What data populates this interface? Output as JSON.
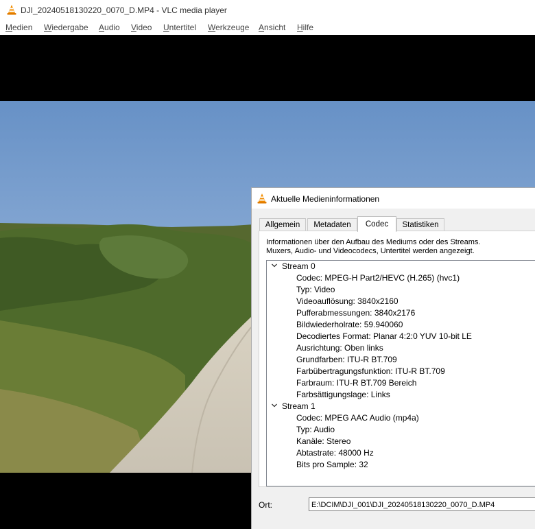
{
  "window": {
    "title": "DJI_20240518130220_0070_D.MP4 - VLC media player"
  },
  "menubar": {
    "items": [
      "Medien",
      "Wiedergabe",
      "Audio",
      "Video",
      "Untertitel",
      "Werkzeuge",
      "Ansicht",
      "Hilfe"
    ]
  },
  "dialog": {
    "title": "Aktuelle Medieninformationen",
    "tabs": [
      "Allgemein",
      "Metadaten",
      "Codec",
      "Statistiken"
    ],
    "active_tab": "Codec",
    "description_line1": "Informationen über den Aufbau des Mediums oder des Streams.",
    "description_line2": "Muxers, Audio- und Videocodecs, Untertitel werden angezeigt.",
    "streams": [
      {
        "label": "Stream 0",
        "props": [
          "Codec: MPEG-H Part2/HEVC (H.265) (hvc1)",
          "Typ: Video",
          "Videoauflösung: 3840x2160",
          "Pufferabmessungen: 3840x2176",
          "Bildwiederholrate: 59.940060",
          "Decodiertes Format: Planar 4:2:0 YUV 10-bit LE",
          "Ausrichtung: Oben links",
          "Grundfarben: ITU-R BT.709",
          "Farbübertragungsfunktion: ITU-R BT.709",
          "Farbraum: ITU-R BT.709 Bereich",
          "Farbsättigungslage: Links"
        ]
      },
      {
        "label": "Stream 1",
        "props": [
          "Codec: MPEG AAC Audio (mp4a)",
          "Typ: Audio",
          "Kanäle: Stereo",
          "Abtastrate: 48000 Hz",
          "Bits pro Sample: 32"
        ]
      }
    ],
    "location_label": "Ort:",
    "location_value": "E:\\DCIM\\DJI_001\\DJI_20240518130220_0070_D.MP4"
  },
  "icons": {
    "app": "vlc-cone-icon",
    "expand": "chevron-down-icon"
  },
  "colors": {
    "vlc_orange": "#f28c00",
    "sky": "#89a9d3",
    "vegetation": "#4f6b2c"
  }
}
